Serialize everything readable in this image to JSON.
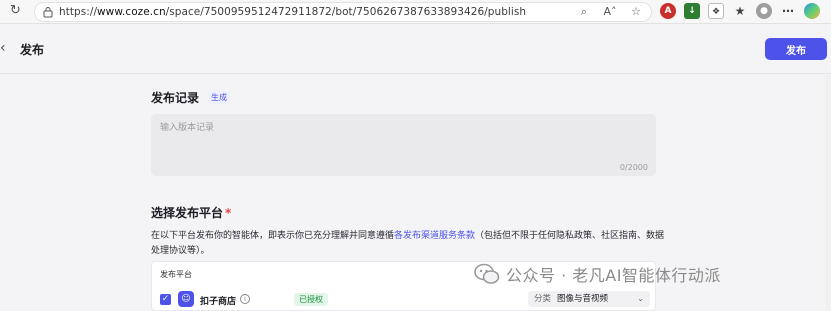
{
  "browser": {
    "url_prefix": "https://",
    "url_host": "www.coze.cn",
    "url_path": "/space/7500959512472911872/bot/7506267387633893426/publish"
  },
  "header": {
    "back_icon": "chevron-left-icon",
    "title": "发布",
    "publish_button": "发布"
  },
  "record": {
    "title": "发布记录",
    "generate_tag": "生成",
    "placeholder": "输入版本记录",
    "counter": "0/2000"
  },
  "platform": {
    "title": "选择发布平台",
    "required_mark": "*",
    "agreement_before": "在以下平台发布你的智能体，即表示你已充分理解并同意遵循",
    "agreement_link": "各发布渠道服务条款",
    "agreement_after": "（包括但不限于任何隐私政策、社区指南、数据处理协议等）。",
    "table_header": "发布平台",
    "rows": [
      {
        "name": "扣子商店",
        "checked": true,
        "status": "已授权",
        "category_label": "分类",
        "category_value": "图像与音视频"
      }
    ]
  },
  "watermark": {
    "text": "公众号 · 老凡AI智能体行动派"
  },
  "colors": {
    "accent": "#4d53e8",
    "authorized": "#1a8f3c",
    "required": "#e54545"
  }
}
